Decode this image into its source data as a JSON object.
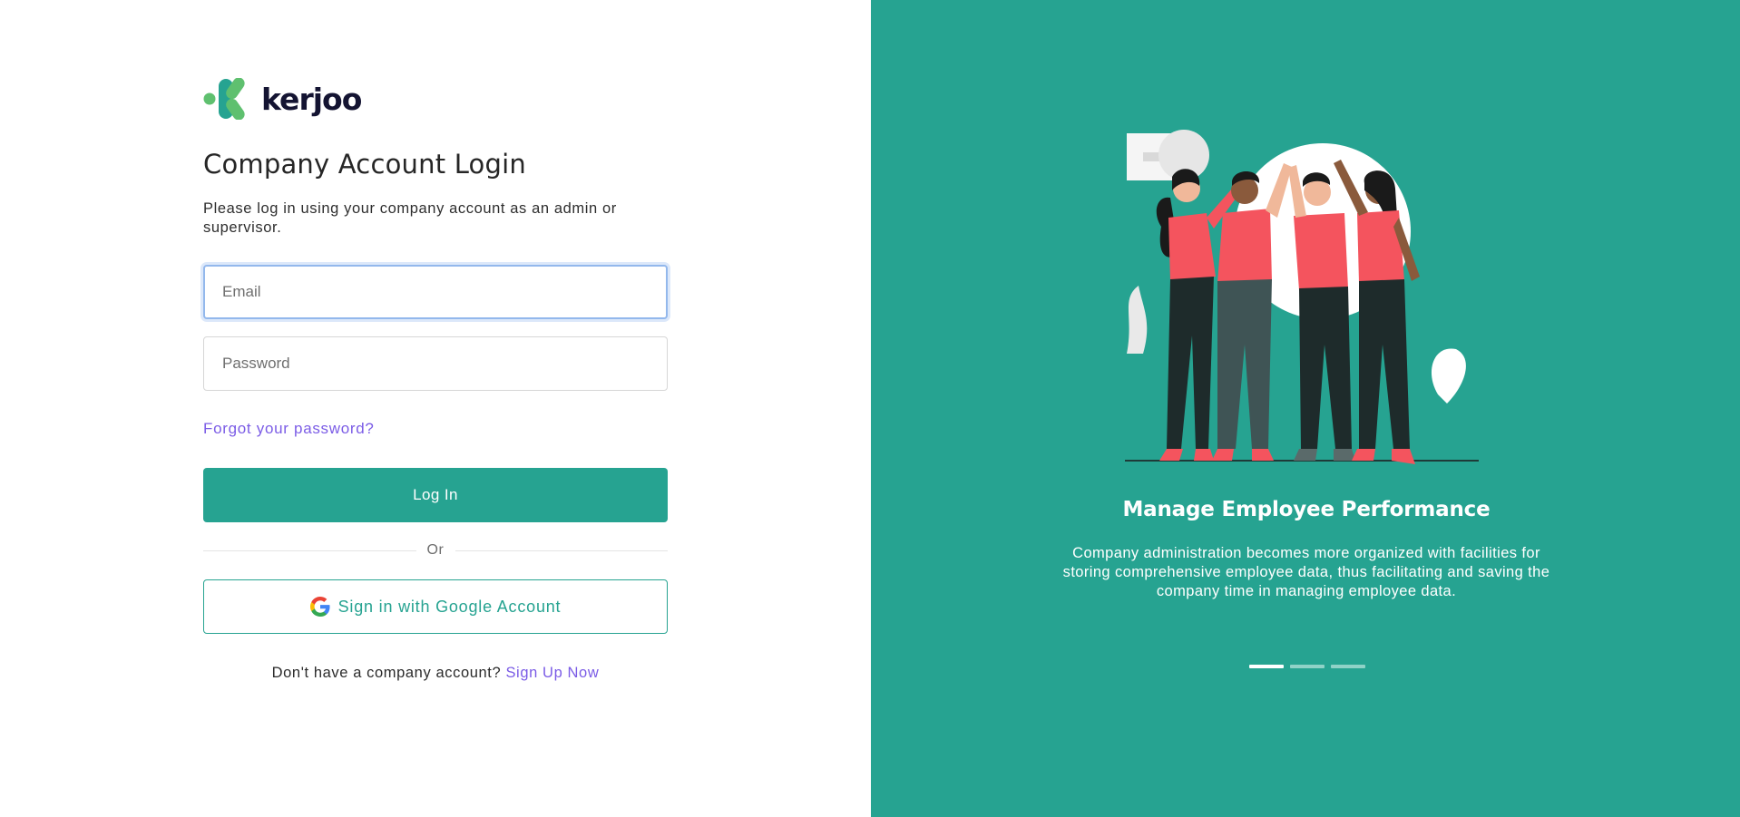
{
  "brand": {
    "name": "kerjoo",
    "accent": "#26a391",
    "link_color": "#7b5ce6"
  },
  "login": {
    "title": "Company Account Login",
    "subtitle": "Please log in using your company account as an admin or supervisor.",
    "email_placeholder": "Email",
    "email_value": "",
    "password_placeholder": "Password",
    "password_value": "",
    "forgot_label": "Forgot your password?",
    "login_label": "Log In",
    "or_label": "Or",
    "google_label": "Sign in with Google Account",
    "signup_prompt": "Don't have a company account?",
    "signup_link": "Sign Up Now"
  },
  "promo": {
    "title": "Manage Employee Performance",
    "description": "Company administration becomes more organized with facilities for storing comprehensive employee data, thus facilitating and saving the company time in managing employee data.",
    "carousel": {
      "count": 3,
      "active_index": 0
    }
  }
}
